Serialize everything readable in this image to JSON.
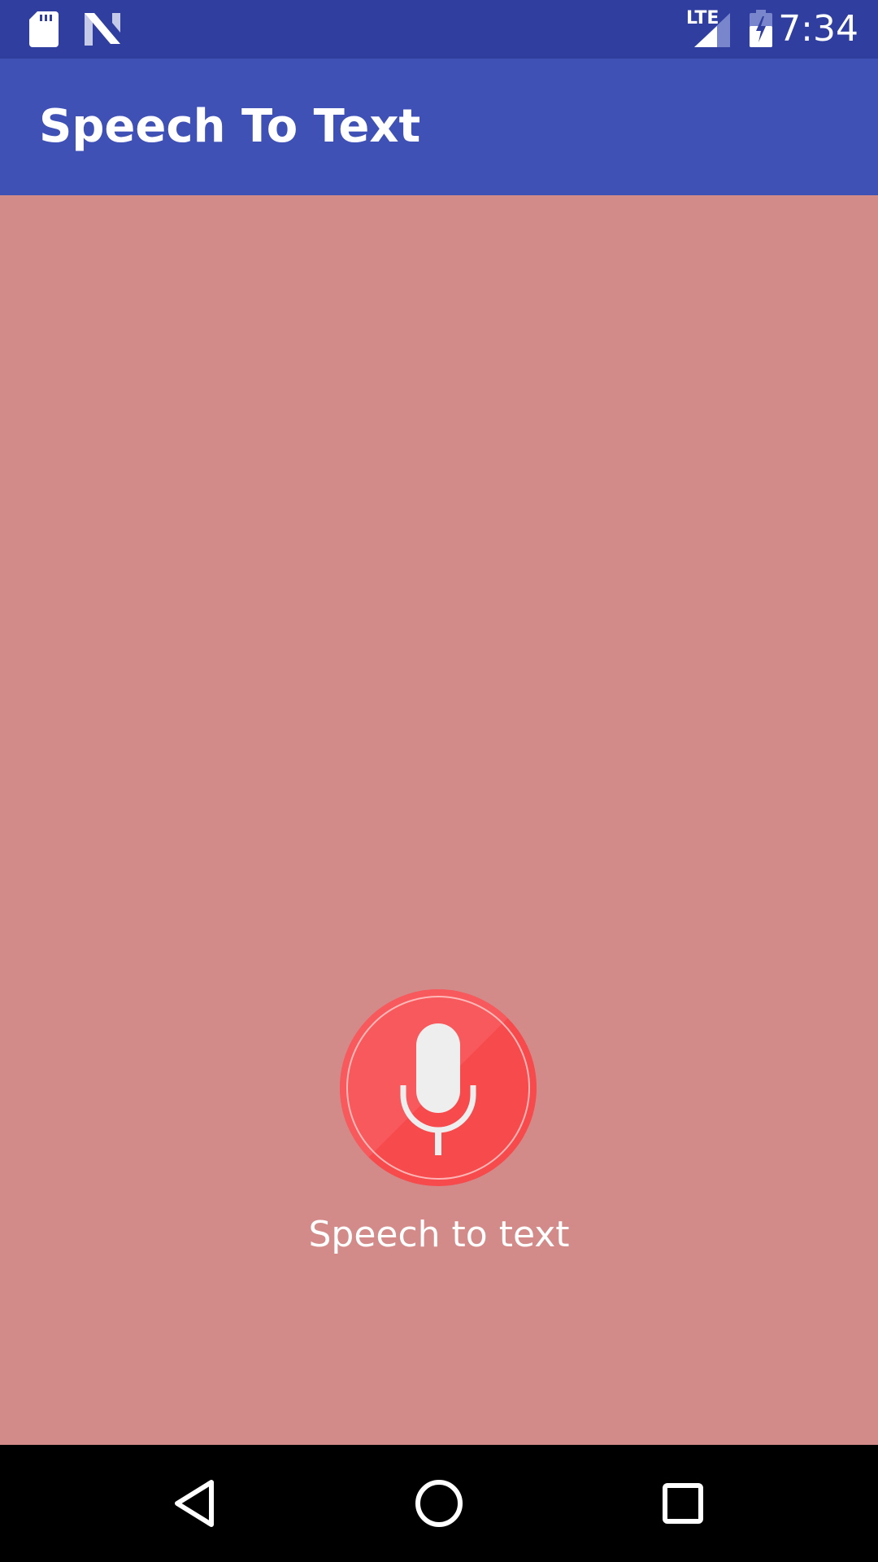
{
  "status_bar": {
    "time": "7:34",
    "network_label": "LTE",
    "icons": [
      "sd-card-icon",
      "n-logo-icon",
      "lte-signal-icon",
      "battery-charging-icon"
    ]
  },
  "app_bar": {
    "title": "Speech To Text",
    "color": "#3f51b5"
  },
  "main": {
    "background_color": "#d28b89",
    "mic_button": {
      "icon": "microphone-icon",
      "color": "#f64a4d"
    },
    "mic_label": "Speech to text"
  },
  "nav_bar": {
    "buttons": [
      "back-icon",
      "home-icon",
      "recents-icon"
    ]
  }
}
